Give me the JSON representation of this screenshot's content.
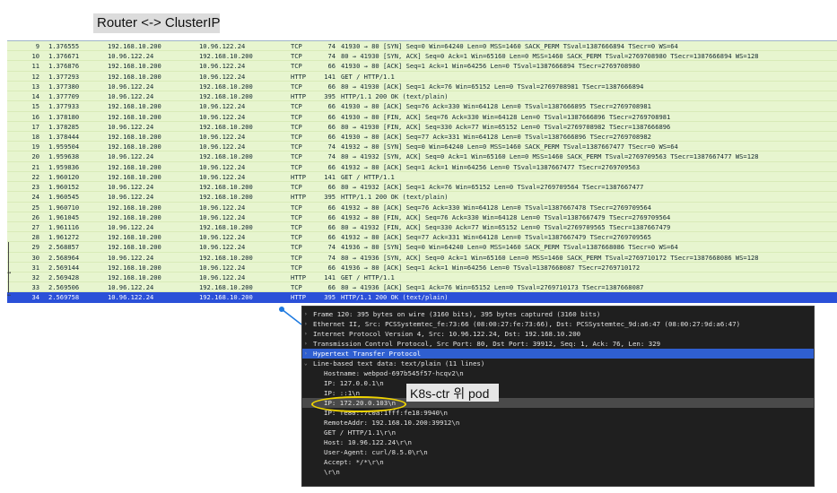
{
  "title": "Router <-> ClusterIP",
  "annotation": "K8s-ctr 위 pod",
  "packets": [
    {
      "no": "9",
      "time": "1.376555",
      "src": "192.168.10.200",
      "dst": "10.96.122.24",
      "proto": "TCP",
      "len": "74",
      "info": "41930 → 80 [SYN] Seq=0 Win=64240 Len=0 MSS=1460 SACK_PERM TSval=1387666894 TSecr=0 WS=64"
    },
    {
      "no": "10",
      "time": "1.376671",
      "src": "10.96.122.24",
      "dst": "192.168.10.200",
      "proto": "TCP",
      "len": "74",
      "info": "80 → 41930 [SYN, ACK] Seq=0 Ack=1 Win=65160 Len=0 MSS=1460 SACK_PERM TSval=2769708980 TSecr=1387666894 WS=128"
    },
    {
      "no": "11",
      "time": "1.376876",
      "src": "192.168.10.200",
      "dst": "10.96.122.24",
      "proto": "TCP",
      "len": "66",
      "info": "41930 → 80 [ACK] Seq=1 Ack=1 Win=64256 Len=0 TSval=1387666894 TSecr=2769708980"
    },
    {
      "no": "12",
      "time": "1.377293",
      "src": "192.168.10.200",
      "dst": "10.96.122.24",
      "proto": "HTTP",
      "len": "141",
      "info": "GET / HTTP/1.1"
    },
    {
      "no": "13",
      "time": "1.377380",
      "src": "10.96.122.24",
      "dst": "192.168.10.200",
      "proto": "TCP",
      "len": "66",
      "info": "80 → 41930 [ACK] Seq=1 Ack=76 Win=65152 Len=0 TSval=2769708981 TSecr=1387666894"
    },
    {
      "no": "14",
      "time": "1.377709",
      "src": "10.96.122.24",
      "dst": "192.168.10.200",
      "proto": "HTTP",
      "len": "395",
      "info": "HTTP/1.1 200 OK  (text/plain)"
    },
    {
      "no": "15",
      "time": "1.377933",
      "src": "192.168.10.200",
      "dst": "10.96.122.24",
      "proto": "TCP",
      "len": "66",
      "info": "41930 → 80 [ACK] Seq=76 Ack=330 Win=64128 Len=0 TSval=1387666895 TSecr=2769708981"
    },
    {
      "no": "16",
      "time": "1.378180",
      "src": "192.168.10.200",
      "dst": "10.96.122.24",
      "proto": "TCP",
      "len": "66",
      "info": "41930 → 80 [FIN, ACK] Seq=76 Ack=330 Win=64128 Len=0 TSval=1387666896 TSecr=2769708981"
    },
    {
      "no": "17",
      "time": "1.378285",
      "src": "10.96.122.24",
      "dst": "192.168.10.200",
      "proto": "TCP",
      "len": "66",
      "info": "80 → 41930 [FIN, ACK] Seq=330 Ack=77 Win=65152 Len=0 TSval=2769708982 TSecr=1387666896"
    },
    {
      "no": "18",
      "time": "1.378444",
      "src": "192.168.10.200",
      "dst": "10.96.122.24",
      "proto": "TCP",
      "len": "66",
      "info": "41930 → 80 [ACK] Seq=77 Ack=331 Win=64128 Len=0 TSval=1387666896 TSecr=2769708982"
    },
    {
      "no": "19",
      "time": "1.959504",
      "src": "192.168.10.200",
      "dst": "10.96.122.24",
      "proto": "TCP",
      "len": "74",
      "info": "41932 → 80 [SYN] Seq=0 Win=64240 Len=0 MSS=1460 SACK_PERM TSval=1387667477 TSecr=0 WS=64"
    },
    {
      "no": "20",
      "time": "1.959638",
      "src": "10.96.122.24",
      "dst": "192.168.10.200",
      "proto": "TCP",
      "len": "74",
      "info": "80 → 41932 [SYN, ACK] Seq=0 Ack=1 Win=65160 Len=0 MSS=1460 SACK_PERM TSval=2769709563 TSecr=1387667477 WS=128"
    },
    {
      "no": "21",
      "time": "1.959836",
      "src": "192.168.10.200",
      "dst": "10.96.122.24",
      "proto": "TCP",
      "len": "66",
      "info": "41932 → 80 [ACK] Seq=1 Ack=1 Win=64256 Len=0 TSval=1387667477 TSecr=2769709563"
    },
    {
      "no": "22",
      "time": "1.960120",
      "src": "192.168.10.200",
      "dst": "10.96.122.24",
      "proto": "HTTP",
      "len": "141",
      "info": "GET / HTTP/1.1"
    },
    {
      "no": "23",
      "time": "1.960152",
      "src": "10.96.122.24",
      "dst": "192.168.10.200",
      "proto": "TCP",
      "len": "66",
      "info": "80 → 41932 [ACK] Seq=1 Ack=76 Win=65152 Len=0 TSval=2769709564 TSecr=1387667477"
    },
    {
      "no": "24",
      "time": "1.960545",
      "src": "10.96.122.24",
      "dst": "192.168.10.200",
      "proto": "HTTP",
      "len": "395",
      "info": "HTTP/1.1 200 OK  (text/plain)"
    },
    {
      "no": "25",
      "time": "1.960710",
      "src": "192.168.10.200",
      "dst": "10.96.122.24",
      "proto": "TCP",
      "len": "66",
      "info": "41932 → 80 [ACK] Seq=76 Ack=330 Win=64128 Len=0 TSval=1387667478 TSecr=2769709564"
    },
    {
      "no": "26",
      "time": "1.961045",
      "src": "192.168.10.200",
      "dst": "10.96.122.24",
      "proto": "TCP",
      "len": "66",
      "info": "41932 → 80 [FIN, ACK] Seq=76 Ack=330 Win=64128 Len=0 TSval=1387667479 TSecr=2769709564"
    },
    {
      "no": "27",
      "time": "1.961116",
      "src": "10.96.122.24",
      "dst": "192.168.10.200",
      "proto": "TCP",
      "len": "66",
      "info": "80 → 41932 [FIN, ACK] Seq=330 Ack=77 Win=65152 Len=0 TSval=2769709565 TSecr=1387667479"
    },
    {
      "no": "28",
      "time": "1.961272",
      "src": "192.168.10.200",
      "dst": "10.96.122.24",
      "proto": "TCP",
      "len": "66",
      "info": "41932 → 80 [ACK] Seq=77 Ack=331 Win=64128 Len=0 TSval=1387667479 TSecr=2769709565"
    },
    {
      "no": "29",
      "time": "2.568857",
      "src": "192.168.10.200",
      "dst": "10.96.122.24",
      "proto": "TCP",
      "len": "74",
      "info": "41936 → 80 [SYN] Seq=0 Win=64240 Len=0 MSS=1460 SACK_PERM TSval=1387668086 TSecr=0 WS=64"
    },
    {
      "no": "30",
      "time": "2.568964",
      "src": "10.96.122.24",
      "dst": "192.168.10.200",
      "proto": "TCP",
      "len": "74",
      "info": "80 → 41936 [SYN, ACK] Seq=0 Ack=1 Win=65160 Len=0 MSS=1460 SACK_PERM TSval=2769710172 TSecr=1387668086 WS=128"
    },
    {
      "no": "31",
      "time": "2.569144",
      "src": "192.168.10.200",
      "dst": "10.96.122.24",
      "proto": "TCP",
      "len": "66",
      "info": "41936 → 80 [ACK] Seq=1 Ack=1 Win=64256 Len=0 TSval=1387668087 TSecr=2769710172"
    },
    {
      "no": "32",
      "time": "2.569428",
      "src": "192.168.10.200",
      "dst": "10.96.122.24",
      "proto": "HTTP",
      "len": "141",
      "info": "GET / HTTP/1.1"
    },
    {
      "no": "33",
      "time": "2.569506",
      "src": "10.96.122.24",
      "dst": "192.168.10.200",
      "proto": "TCP",
      "len": "66",
      "info": "80 → 41936 [ACK] Seq=1 Ack=76 Win=65152 Len=0 TSval=2769710173 TSecr=1387668087"
    },
    {
      "no": "34",
      "time": "2.569758",
      "src": "10.96.122.24",
      "dst": "192.168.10.200",
      "proto": "HTTP",
      "len": "395",
      "info": "HTTP/1.1 200 OK  (text/plain)",
      "selected": true
    }
  ],
  "details": [
    {
      "text": "Frame 120: 395 bytes on wire (3160 bits), 395 bytes captured (3160 bits)",
      "arrow": "›",
      "kind": "normal"
    },
    {
      "text": "Ethernet II, Src: PCSSystemtec_fe:73:66 (08:00:27:fe:73:66), Dst: PCSSystemtec_9d:a6:47 (08:00:27:9d:a6:47)",
      "arrow": "›",
      "kind": "normal"
    },
    {
      "text": "Internet Protocol Version 4, Src: 10.96.122.24, Dst: 192.168.10.200",
      "arrow": "›",
      "kind": "normal"
    },
    {
      "text": "Transmission Control Protocol, Src Port: 80, Dst Port: 39912, Seq: 1, Ack: 76, Len: 329",
      "arrow": "›",
      "kind": "normal"
    },
    {
      "text": "Hypertext Transfer Protocol",
      "arrow": "›",
      "kind": "http"
    },
    {
      "text": "Line-based text data: text/plain (11 lines)",
      "arrow": "⌄",
      "kind": "normal"
    },
    {
      "text": "Hostname: webpod-697b545f57-hcqv2\\n",
      "arrow": "",
      "kind": "indent"
    },
    {
      "text": "IP: 127.0.0.1\\n",
      "arrow": "",
      "kind": "indent"
    },
    {
      "text": "IP: ::1\\n",
      "arrow": "",
      "kind": "indent"
    },
    {
      "text": "IP: 172.20.0.103\\n",
      "arrow": "",
      "kind": "indent-sel"
    },
    {
      "text": "IP: fe80::7c0a:1fff:fe18:9940\\n",
      "arrow": "",
      "kind": "indent"
    },
    {
      "text": "RemoteAddr: 192.168.10.200:39912\\n",
      "arrow": "",
      "kind": "indent"
    },
    {
      "text": "GET / HTTP/1.1\\r\\n",
      "arrow": "",
      "kind": "indent"
    },
    {
      "text": "Host: 10.96.122.24\\r\\n",
      "arrow": "",
      "kind": "indent"
    },
    {
      "text": "User-Agent: curl/8.5.0\\r\\n",
      "arrow": "",
      "kind": "indent"
    },
    {
      "text": "Accept: */*\\r\\n",
      "arrow": "",
      "kind": "indent"
    },
    {
      "text": "\\r\\n",
      "arrow": "",
      "kind": "indent"
    }
  ],
  "colors": {
    "tcp_row": "#e7f5cf",
    "selected_row": "#2b50d8",
    "pane_bg": "#1f1f1f",
    "highlight_circle": "#f0d400",
    "connector": "#1e7ae0"
  }
}
